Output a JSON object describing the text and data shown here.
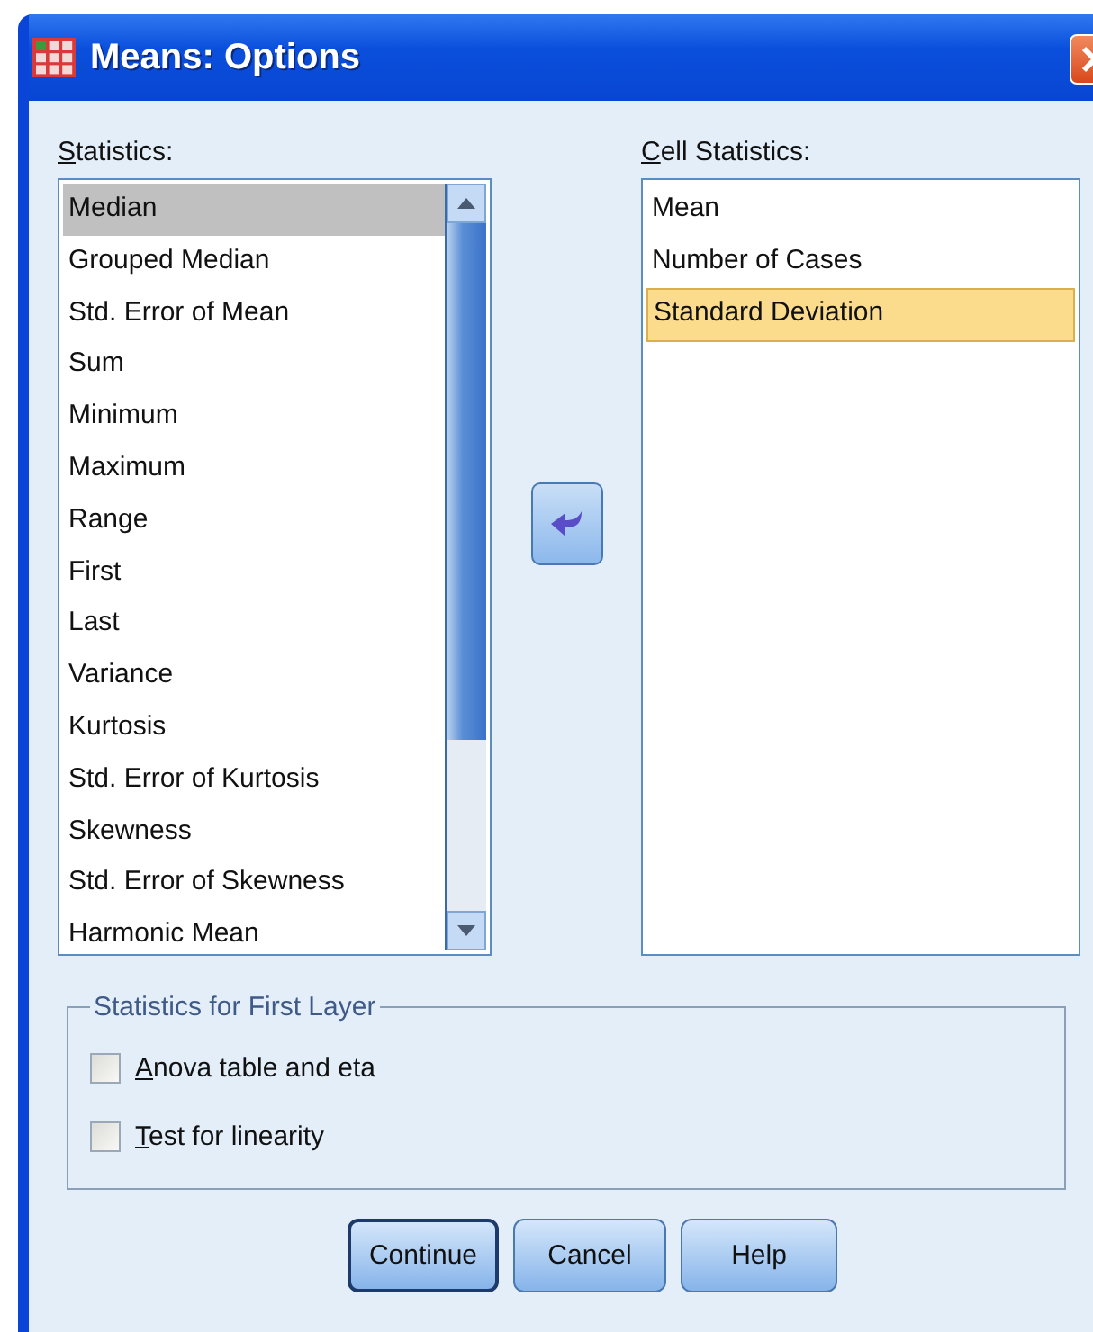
{
  "window": {
    "title": "Means: Options"
  },
  "statistics": {
    "label": "Statistics:",
    "items": [
      {
        "label": "Median",
        "selected": true
      },
      {
        "label": "Grouped Median",
        "selected": false
      },
      {
        "label": "Std. Error of Mean",
        "selected": false
      },
      {
        "label": "Sum",
        "selected": false
      },
      {
        "label": "Minimum",
        "selected": false
      },
      {
        "label": "Maximum",
        "selected": false
      },
      {
        "label": "Range",
        "selected": false
      },
      {
        "label": "First",
        "selected": false
      },
      {
        "label": "Last",
        "selected": false
      },
      {
        "label": "Variance",
        "selected": false
      },
      {
        "label": "Kurtosis",
        "selected": false
      },
      {
        "label": "Std. Error of Kurtosis",
        "selected": false
      },
      {
        "label": "Skewness",
        "selected": false
      },
      {
        "label": "Std. Error of Skewness",
        "selected": false
      },
      {
        "label": "Harmonic Mean",
        "selected": false
      }
    ]
  },
  "cell_statistics": {
    "label": "Cell Statistics:",
    "items": [
      {
        "label": "Mean",
        "selected": false
      },
      {
        "label": "Number of Cases",
        "selected": false
      },
      {
        "label": "Standard Deviation",
        "selected": true
      }
    ]
  },
  "first_layer": {
    "title": "Statistics for First Layer",
    "options": [
      {
        "label": "Anova table and eta",
        "checked": false
      },
      {
        "label": "Test for linearity",
        "checked": false
      }
    ]
  },
  "buttons": [
    {
      "label": "Continue",
      "default": true
    },
    {
      "label": "Cancel",
      "default": false
    },
    {
      "label": "Help",
      "default": false
    }
  ]
}
